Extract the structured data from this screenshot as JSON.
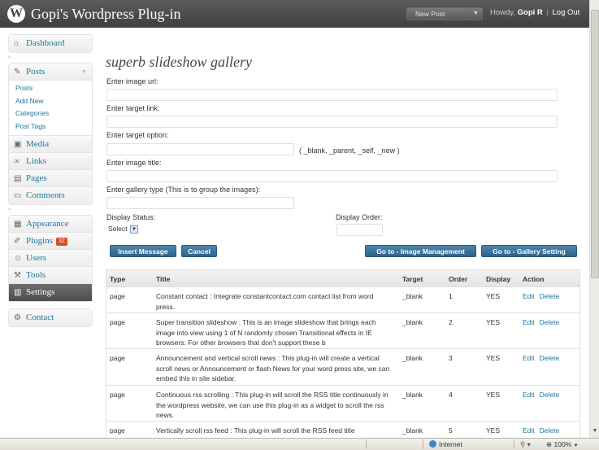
{
  "header": {
    "logo": "W",
    "title": "Gopi's Wordpress Plug-in",
    "new_post": "New Post",
    "new_post_arrow": "▼",
    "howdy": "Howdy,",
    "user": "Gopi R",
    "separator": "|",
    "logout": "Log Out"
  },
  "sidebar": {
    "dashboard": "Dashboard",
    "posts": "Posts",
    "posts_sub": [
      "Posts",
      "Add New",
      "Categories",
      "Post Tags"
    ],
    "media": "Media",
    "links": "Links",
    "pages": "Pages",
    "comments": "Comments",
    "appearance": "Appearance",
    "plugins": "Plugins",
    "plugins_badge": "32",
    "users": "Users",
    "tools": "Tools",
    "settings": "Settings",
    "contact": "Contact"
  },
  "form": {
    "title": "superb slideshow gallery",
    "image_url_label": "Enter image url:",
    "target_link_label": "Enter target link:",
    "target_option_label": "Enter target option:",
    "target_option_hint": "( _blank, _parent, _self, _new )",
    "image_title_label": "Enter image title:",
    "gallery_type_label": "Enter gallery type (This is to group the images):",
    "display_status_label": "Display Status:",
    "display_status_value": "Select",
    "display_order_label": "Display Order:",
    "insert_button": "Insert Message",
    "cancel_button": "Cancel",
    "image_mgmt_button": "Go to - Image Management",
    "gallery_setting_button": "Go to - Gallery Setting"
  },
  "table": {
    "headers": [
      "Type",
      "Title",
      "Target",
      "Order",
      "Display",
      "Action"
    ],
    "rows": [
      {
        "type": "page",
        "title": "Constant contact : Integrate constantcontact.com contact list from word press.",
        "target": "_blank",
        "order": "1",
        "display": "YES",
        "edit": "Edit",
        "delete": "Delete"
      },
      {
        "type": "page",
        "title": "Super transition slideshow : This is an image slideshow that brings each image into view using 1 of N randomly chosen Transitional effects in IE browsers. For other browsers that don't support these b",
        "target": "_blank",
        "order": "2",
        "display": "YES",
        "edit": "Edit",
        "delete": "Delete"
      },
      {
        "type": "page",
        "title": "Announcement and vertical scroll news : This plug-in will create a vertical scroll news or Announcement or flash News for your word press site, we can embed this in site sidebar.",
        "target": "_blank",
        "order": "3",
        "display": "YES",
        "edit": "Edit",
        "delete": "Delete"
      },
      {
        "type": "page",
        "title": "Continuous rss scrolling : This plug-in will scroll the RSS title continuously in the wordpress website, we can use this plug-in as a widget to scroll the rss news.",
        "target": "_blank",
        "order": "4",
        "display": "YES",
        "edit": "Edit",
        "delete": "Delete"
      },
      {
        "type": "page",
        "title": "Vertically scroll rss feed : This plug-in will scroll the RSS feed title",
        "target": "_blank",
        "order": "5",
        "display": "YES",
        "edit": "Edit",
        "delete": "Delete"
      }
    ]
  },
  "statusbar": {
    "zone": "Internet",
    "zoom": "100%",
    "zoom_arrow": "▼"
  },
  "colors": {
    "header_bg": "#464646",
    "link": "#21759b",
    "button": "#3a6f96",
    "badge": "#d54e21"
  }
}
